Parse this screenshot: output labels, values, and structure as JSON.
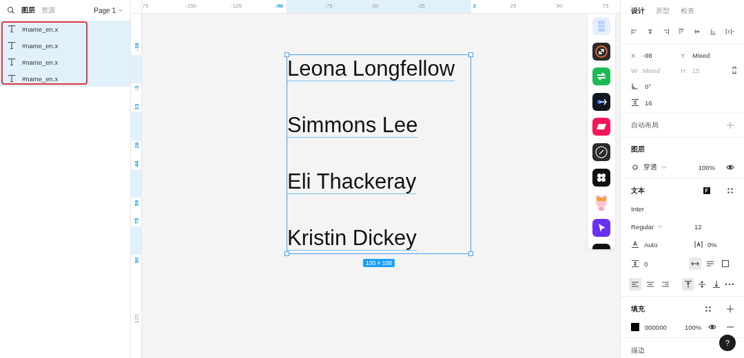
{
  "layers_panel": {
    "tabs": [
      {
        "label": "图层",
        "selected": true
      },
      {
        "label": "资源",
        "selected": false
      }
    ],
    "page": "Page 1",
    "layers": [
      {
        "name": "#name_en.x",
        "selected": true
      },
      {
        "name": "#name_en.x",
        "selected": true
      },
      {
        "name": "#name_en.x",
        "selected": true
      },
      {
        "name": "#name_en.x",
        "selected": true
      }
    ]
  },
  "rulers": {
    "top": [
      {
        "label": "75",
        "highlight": false
      },
      {
        "label": "-150",
        "highlight": false
      },
      {
        "label": "-125",
        "highlight": false
      },
      {
        "label": "-98",
        "highlight": true
      },
      {
        "label": "-75",
        "highlight": false
      },
      {
        "label": "-50",
        "highlight": false
      },
      {
        "label": "-25",
        "highlight": false
      },
      {
        "label": "2",
        "highlight": true
      },
      {
        "label": "25",
        "highlight": false
      },
      {
        "label": "50",
        "highlight": false
      },
      {
        "label": "75",
        "highlight": false
      }
    ],
    "left": [
      {
        "label": "-18",
        "highlight": true
      },
      {
        "label": "-3",
        "highlight": true
      },
      {
        "label": "13",
        "highlight": true
      },
      {
        "label": "28",
        "highlight": true
      },
      {
        "label": "44",
        "highlight": true
      },
      {
        "label": "59",
        "highlight": true
      },
      {
        "label": "75",
        "highlight": true
      },
      {
        "label": "90",
        "highlight": true
      },
      {
        "label": "125",
        "highlight": false
      }
    ]
  },
  "canvas": {
    "texts": [
      "Leona Longfellow",
      "Simmons Lee",
      "Eli Thackeray",
      "Kristin Dickey"
    ],
    "size_badge": "100 × 108"
  },
  "inspector": {
    "tabs": [
      {
        "label": "设计",
        "selected": true
      },
      {
        "label": "原型",
        "selected": false
      },
      {
        "label": "检查",
        "selected": false
      }
    ],
    "position": [
      {
        "label": "X",
        "value": "-98",
        "disabled": false
      },
      {
        "label": "Y",
        "value": "Mixed",
        "disabled": false
      },
      {
        "label": "W",
        "value": "Mixed",
        "disabled": true
      },
      {
        "label": "H",
        "value": "15",
        "disabled": true
      }
    ],
    "rotation": "0°",
    "spacing": "16",
    "auto_layout": "自动布局",
    "layer": {
      "title": "图层",
      "blend": "穿透",
      "opacity": "100%"
    },
    "text": {
      "title": "文本",
      "font": "Inter",
      "weight": "Regular",
      "size": "12",
      "line_height": "Auto",
      "letter_spacing": "0%",
      "paragraph_spacing": "0",
      "resizing": [
        {
          "selected": true
        },
        {
          "selected": false
        },
        {
          "selected": false
        }
      ],
      "align": [
        {
          "selected": true
        },
        {
          "selected": false
        },
        {
          "selected": false
        }
      ],
      "vertical_align": [
        {
          "selected": true
        },
        {
          "selected": false
        },
        {
          "selected": false
        }
      ]
    },
    "fill": {
      "title": "填充",
      "color": "#000000",
      "hex": "000000",
      "opacity": "100%"
    },
    "stroke": {
      "title": "描边"
    },
    "help": "?"
  }
}
